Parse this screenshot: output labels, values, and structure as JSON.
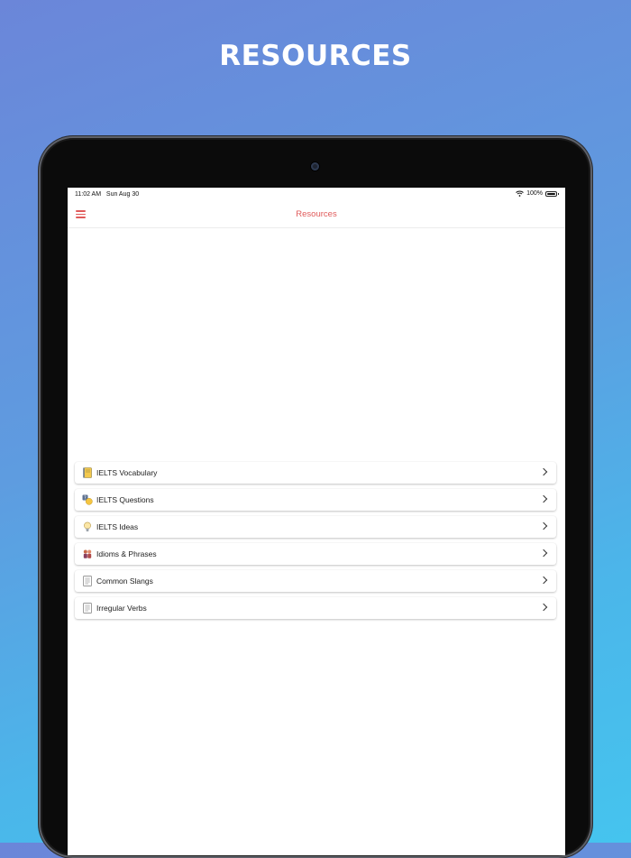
{
  "headline": "RESOURCES",
  "status_bar": {
    "time": "11:02 AM",
    "date": "Sun Aug 30",
    "battery": "100%"
  },
  "navbar": {
    "title": "Resources",
    "menu_icon": "hamburger-icon",
    "accent_color": "#e05a5a"
  },
  "resources": [
    {
      "label": "IELTS Vocabulary",
      "icon": "notebook-icon"
    },
    {
      "label": "IELTS Questions",
      "icon": "question-hand-icon"
    },
    {
      "label": "IELTS Ideas",
      "icon": "lightbulb-icon"
    },
    {
      "label": "Idioms & Phrases",
      "icon": "people-icon"
    },
    {
      "label": "Common Slangs",
      "icon": "document-icon"
    },
    {
      "label": "Irregular Verbs",
      "icon": "document-icon"
    }
  ]
}
